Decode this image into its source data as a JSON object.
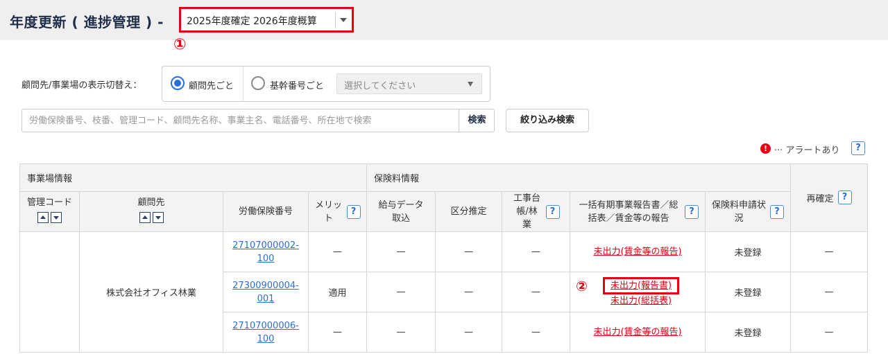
{
  "header": {
    "title": "年度更新 ( 進捗管理 ) -",
    "year_select": "2025年度確定 2026年度概算",
    "marker_1": "①"
  },
  "toggle": {
    "label": "顧問先/事業場の表示切替え：",
    "option_client": "顧問先ごと",
    "option_base_number": "基幹番号ごと",
    "select_placeholder": "選択してください",
    "selected": "option_client"
  },
  "search": {
    "placeholder": "労働保険番号、枝番、管理コード、顧問先名称、事業主名、電話番号、所在地で検索",
    "search_button": "検索",
    "filter_button": "絞り込み検索"
  },
  "alert_legend": {
    "icon": "!",
    "text": "··· アラートあり",
    "help": "?"
  },
  "table": {
    "group_headers": {
      "site_info": "事業場情報",
      "premium_info": "保険料情報"
    },
    "columns": {
      "management_code": "管理コード",
      "client": "顧問先",
      "insurance_number": "労働保険番号",
      "merit": "メリット",
      "salary_import": "給与データ取込",
      "category_estimate": "区分推定",
      "construction_forestry": "工事台帳/林業",
      "report": "一括有期事業報告書／総括表／賃金等の報告",
      "premium_status": "保険料申請状況",
      "reconfirm": "再確定"
    },
    "help_label": "?",
    "client_name": "株式会社オフィス林業",
    "dash": "—",
    "rows": [
      {
        "insurance_number": "27107000002-100",
        "merit": "—",
        "report_lines": [
          "未出力(賃金等の報告)"
        ],
        "premium_status": "未登録"
      },
      {
        "insurance_number": "27300900004-001",
        "merit": "適用",
        "report_lines": [
          "未出力(報告書)",
          "未出力(総括表)"
        ],
        "premium_status": "未登録",
        "marker": "②"
      },
      {
        "insurance_number": "27107000006-100",
        "merit": "—",
        "report_lines": [
          "未出力(賃金等の報告)"
        ],
        "premium_status": "未登録"
      }
    ]
  }
}
